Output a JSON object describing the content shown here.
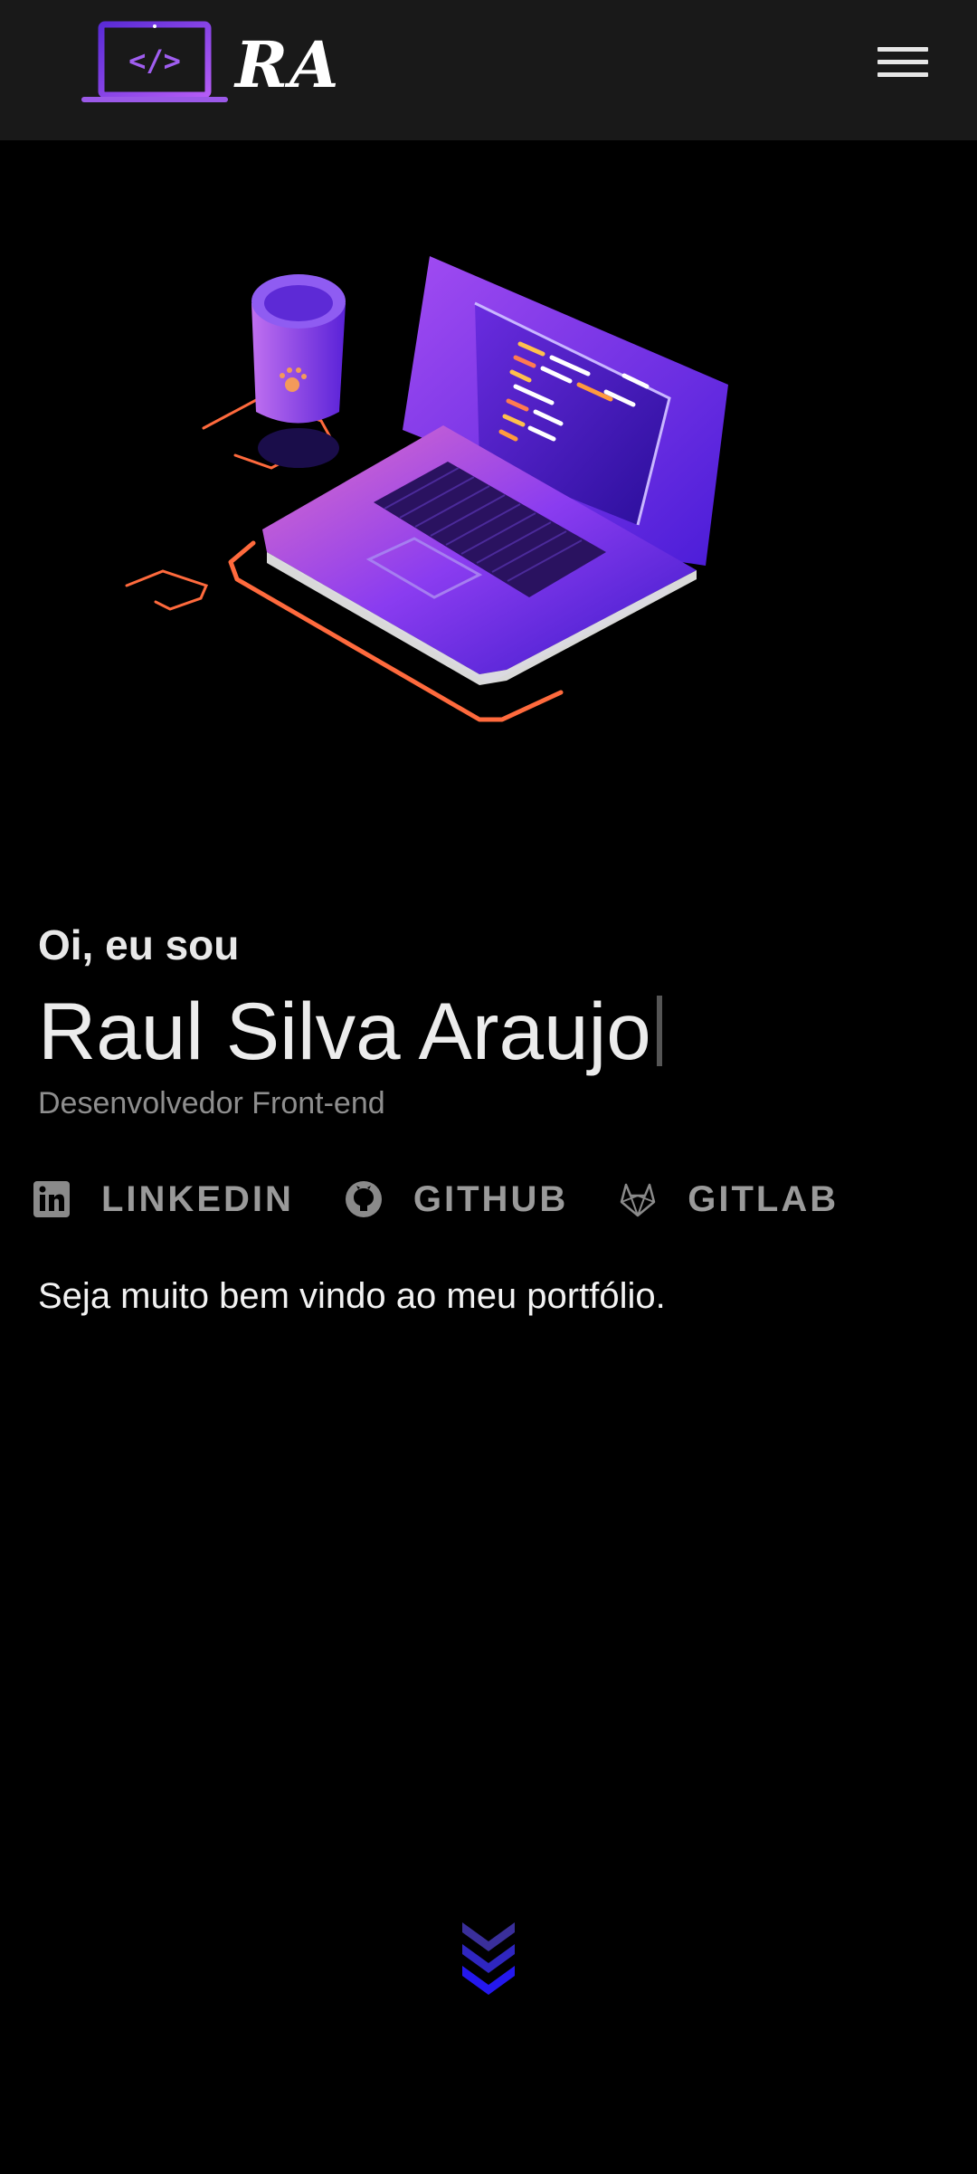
{
  "header": {
    "logo_code_text": "</>",
    "logo_text": "RA"
  },
  "hero": {
    "intro": "Oi, eu sou",
    "name": "Raul Silva Araujo",
    "role": "Desenvolvedor Front-end",
    "welcome": "Seja muito bem vindo ao meu portfólio."
  },
  "social": [
    {
      "label": "LINKEDIN",
      "icon": "linkedin-icon"
    },
    {
      "label": "GITHUB",
      "icon": "github-icon"
    },
    {
      "label": "GITLAB",
      "icon": "gitlab-icon"
    }
  ],
  "colors": {
    "header_bg": "#191919",
    "page_bg": "#000000",
    "accent_purple": "#8a3cf0",
    "accent_orange": "#ff6a3d",
    "scroll_blue": "#2a1fe0"
  }
}
